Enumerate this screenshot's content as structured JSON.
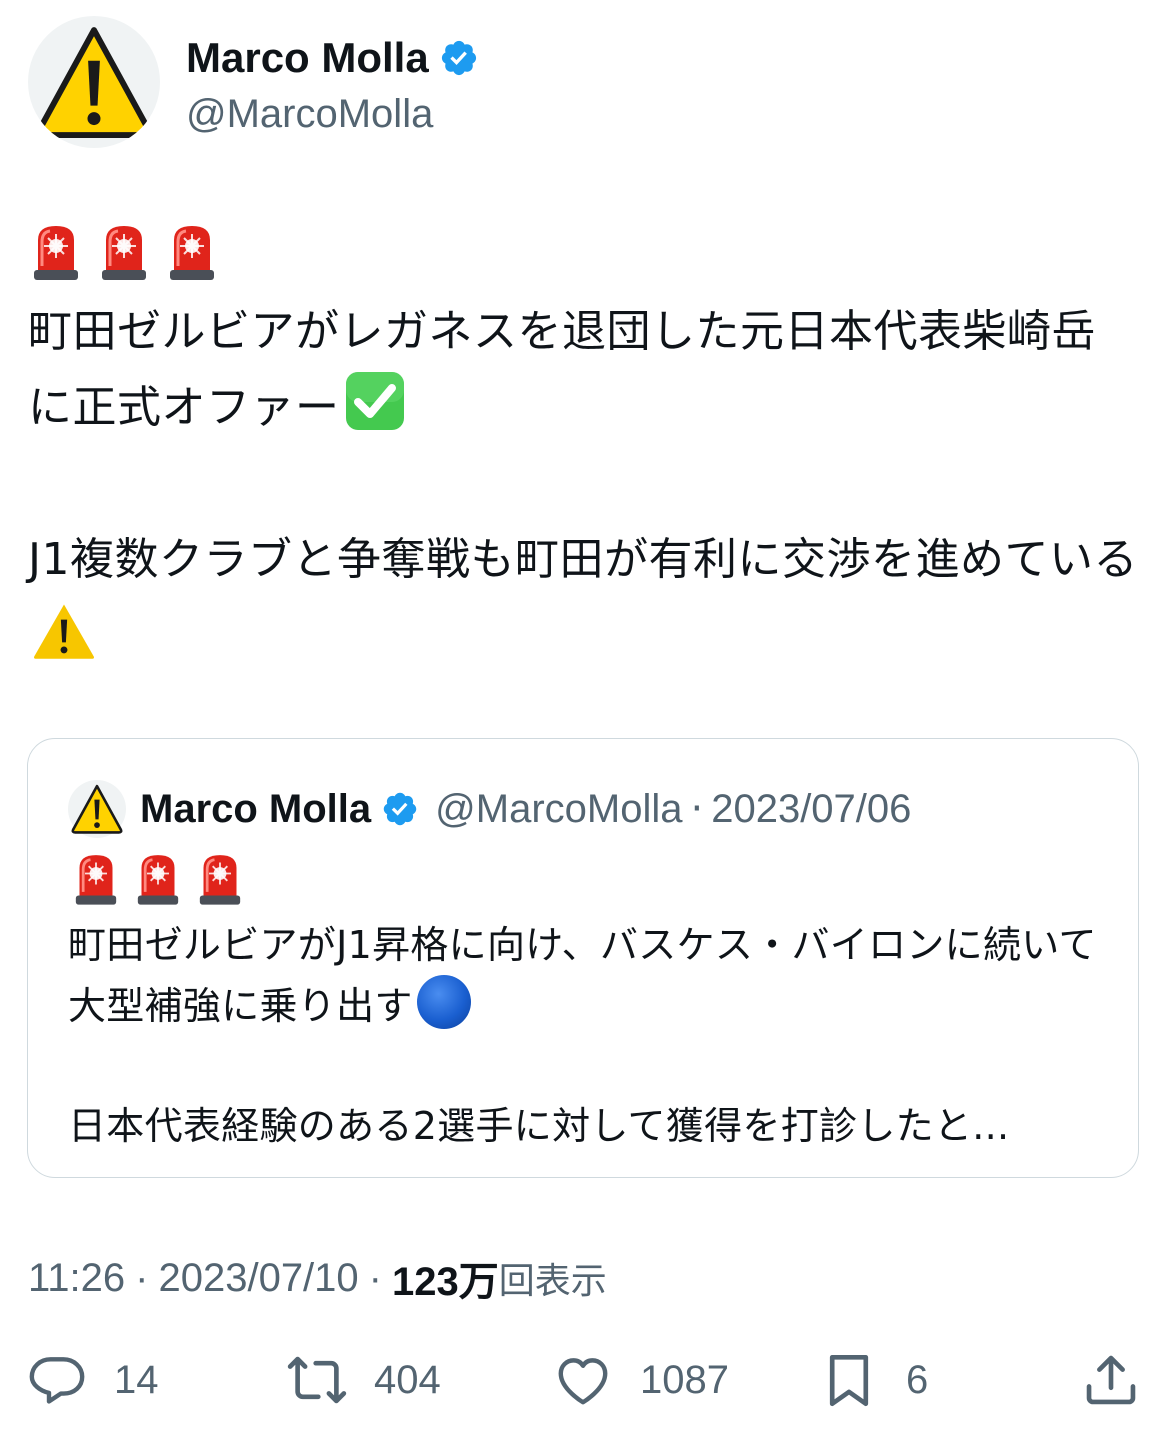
{
  "tweet": {
    "author_name": "Marco Molla",
    "author_handle": "@MarcoMolla",
    "avatar_icon": "warning-icon",
    "verified_icon": "verified-badge-icon",
    "emoji_row": [
      "police-car-light",
      "police-car-light",
      "police-car-light"
    ],
    "paragraph1": "町田ゼルビアがレガネスを退団した元日本代表柴崎岳に正式オファー",
    "paragraph1_emoji": "check-mark-button",
    "paragraph2": "J1複数クラブと争奪戦も町田が有利に交渉を進めている",
    "paragraph2_emoji": "warning-icon"
  },
  "quote": {
    "author_name": "Marco Molla",
    "author_handle": "@MarcoMolla",
    "separator": "·",
    "date": "2023/07/06",
    "emoji_row": [
      "police-car-light",
      "police-car-light",
      "police-car-light"
    ],
    "line1": "町田ゼルビアがJ1昇格に向け、バスケス・バイロンに続いて大型補強に乗り出す",
    "line1_emoji": "blue-circle",
    "line2": "日本代表経験のある2選手に対して獲得を打診したと..."
  },
  "meta": {
    "time": "11:26",
    "separator": "·",
    "date": "2023/07/10",
    "views": "123万",
    "views_label": "回表示"
  },
  "actions": {
    "reply_count": "14",
    "retweet_count": "404",
    "like_count": "1087",
    "bookmark_count": "6"
  },
  "colors": {
    "text": "#0f1419",
    "secondary": "#536471",
    "verified": "#1d9bf0",
    "border": "#cfd9de",
    "warning_yellow": "#ffdd00",
    "siren_red": "#e0241b"
  }
}
